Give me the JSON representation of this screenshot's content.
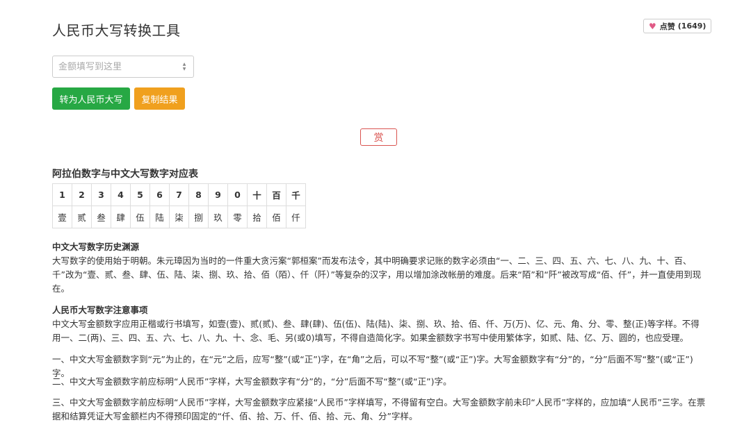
{
  "header": {
    "title": "人民币大写转换工具",
    "like_label": "点赞",
    "like_count": "(1649)"
  },
  "input": {
    "placeholder": "金额填写到这里",
    "value": ""
  },
  "buttons": {
    "convert": "转为人民币大写",
    "copy": "复制结果",
    "reward": "赏"
  },
  "table_section": {
    "title": "阿拉伯数字与中文大写数字对应表",
    "digits": [
      "1",
      "2",
      "3",
      "4",
      "5",
      "6",
      "7",
      "8",
      "9",
      "0",
      "十",
      "百",
      "千"
    ],
    "capitals": [
      "壹",
      "贰",
      "叁",
      "肆",
      "伍",
      "陆",
      "柒",
      "捌",
      "玖",
      "零",
      "拾",
      "佰",
      "仟"
    ]
  },
  "history": {
    "title": "中文大写数字历史渊源",
    "body": "大写数字的使用始于明朝。朱元璋因为当时的一件重大贪污案“郭桓案”而发布法令，其中明确要求记账的数字必须由“一、二、三、四、五、六、七、八、九、十、百、千”改为“壹、贰、叁、肆、伍、陆、柒、捌、玖、拾、佰（陌）、仟（阡）”等复杂的汉字，用以增加涂改帐册的难度。后来“陌”和“阡”被改写成“佰、仟”，并一直使用到现在。"
  },
  "notes": {
    "title": "人民币大写数字注意事项",
    "body": "中文大写金额数字应用正楷或行书填写，如壹(壹)、贰(贰)、叁、肆(肆)、伍(伍)、陆(陆)、柒、捌、玖、拾、佰、仟、万(万)、亿、元、角、分、零、整(正)等字样。不得用一、二(两)、三、四、五、六、七、八、九、十、念、毛、另(或0)填写，不得自造简化字。如果金额数字书写中使用繁体字，如贰、陆、亿、万、圆的，也应受理。",
    "para1": "一、中文大写金额数字到“元”为止的，在“元”之后，应写“整”(或“正”)字，在“角”之后，可以不写“整”(或“正”)字。大写金额数字有“分”的，“分”后面不写“整”(或“正”)字。",
    "para2": "二、中文大写金额数字前应标明“人民币”字样，大写金额数字有“分”的，“分”后面不写“整”(或“正”)字。",
    "para3": "三、中文大写金额数字前应标明“人民币”字样，大写金额数字应紧接“人民币”字样填写，不得留有空白。大写金额数字前未印“人民币”字样的，应加填“人民币”三字。在票据和结算凭证大写金额栏内不得预印固定的“仟、佰、拾、万、仟、佰、拾、元、角、分”字样。"
  },
  "colors": {
    "convert_button": "#27a844",
    "copy_button": "#f0a01e",
    "reward_border": "#d9534f",
    "heart": "#e05a86"
  }
}
